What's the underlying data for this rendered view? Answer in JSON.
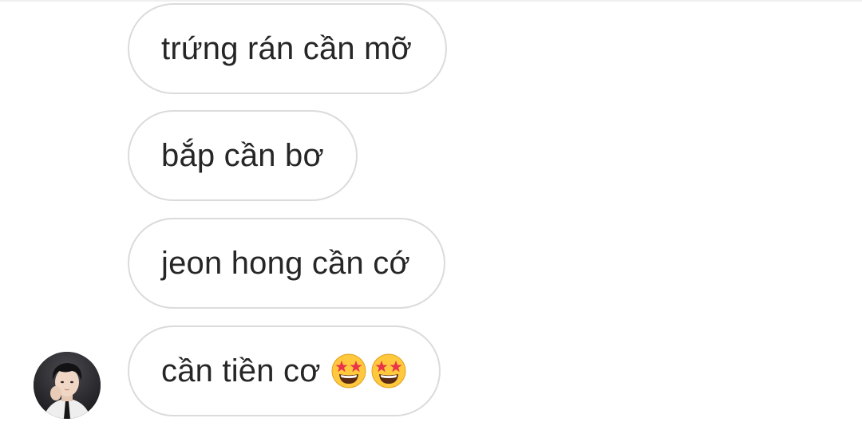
{
  "messages": [
    {
      "text": "trứng rán cần mỡ"
    },
    {
      "text": "bắp cần bơ"
    },
    {
      "text": "jeon hong cần cớ"
    },
    {
      "text": "cần tiền cơ",
      "emojis": [
        "star-struck-emoji",
        "star-struck-emoji"
      ]
    }
  ],
  "colors": {
    "bubble_border": "#dbdbdb",
    "text": "#262626",
    "background": "#ffffff",
    "emoji_face": "#ffc83d",
    "emoji_stars": "#e8334a"
  },
  "avatar": {
    "icon": "profile-photo"
  }
}
